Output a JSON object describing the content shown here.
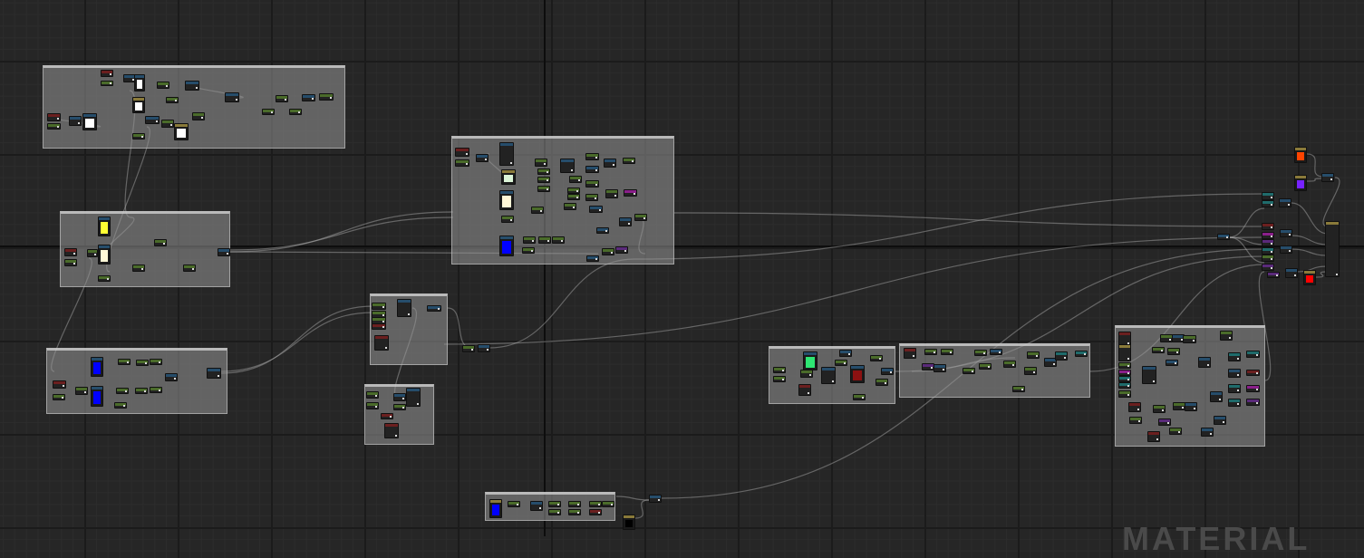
{
  "app": {
    "graph_type": "material-graph",
    "watermark": "MATERIAL"
  },
  "colors": {
    "background": "#262626",
    "comment_box": "#969696",
    "wire": "#b4b4b4",
    "param_header": "#4a6b2a",
    "texture_header": "#264d6b",
    "math_header": "#6b1f1f",
    "output_node": "#8a7a3a",
    "swatches": [
      "#ffffff",
      "#ffff33",
      "#fff7d6",
      "#0000ff",
      "#2ee673",
      "#8c1111",
      "#ff4400",
      "#7722ff",
      "#ff0000",
      "#000000",
      "#dcf5d8"
    ]
  },
  "graph": {
    "comment_boxes": 11,
    "nodes_visible": "many",
    "result_node": "material-output"
  }
}
